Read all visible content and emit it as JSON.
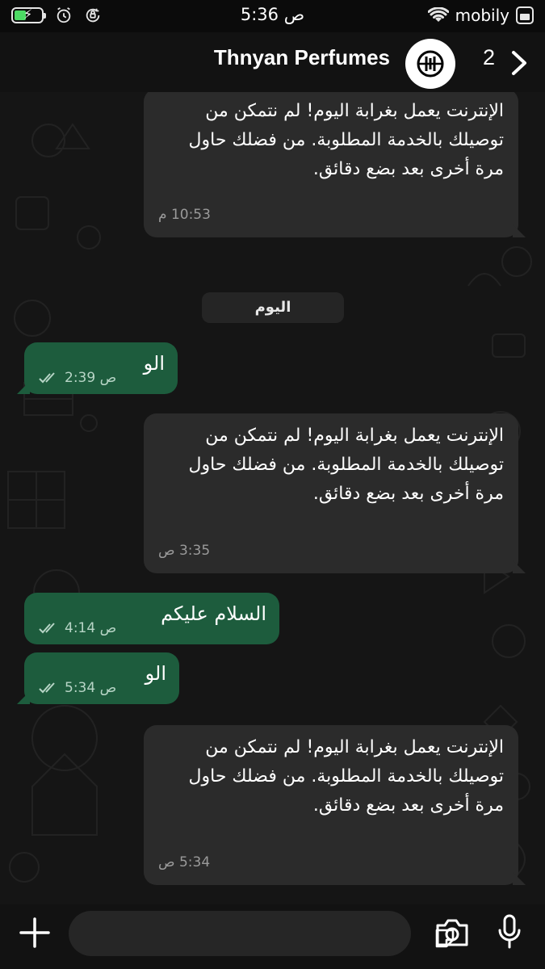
{
  "status_bar": {
    "time": "5:36 ص",
    "carrier": "mobily",
    "icons": [
      "battery-charging-icon",
      "alarm-icon",
      "orientation-lock-icon",
      "wifi-icon",
      "battery-icon"
    ]
  },
  "header": {
    "contact_name": "Thnyan Perfumes",
    "unread_count": "2",
    "avatar_icon": "business-logo-icon",
    "forward_icon": "chevron-right-icon"
  },
  "messages": [
    {
      "direction": "in",
      "text": "الإنترنت يعمل بغرابة اليوم! لم نتمكن من توصيلك بالخدمة المطلوبة. من فضلك حاول مرة أخرى بعد بضع دقائق.",
      "time": "10:53 م"
    },
    {
      "direction": "out",
      "text": "الو",
      "time": "2:39 ص",
      "status": "read"
    },
    {
      "direction": "in",
      "text": "الإنترنت يعمل بغرابة اليوم! لم نتمكن من توصيلك بالخدمة المطلوبة. من فضلك حاول مرة أخرى بعد بضع دقائق.",
      "time": "3:35 ص"
    },
    {
      "direction": "out",
      "text": "السلام عليكم",
      "time": "4:14 ص",
      "status": "read"
    },
    {
      "direction": "out",
      "text": "الو",
      "time": "5:34 ص",
      "status": "read"
    },
    {
      "direction": "in",
      "text": "الإنترنت يعمل بغرابة اليوم! لم نتمكن من توصيلك بالخدمة المطلوبة. من فضلك حاول مرة أخرى بعد بضع دقائق.",
      "time": "5:34 ص"
    }
  ],
  "date_divider": "اليوم",
  "input_bar": {
    "placeholder": "",
    "icons": [
      "plus-icon",
      "sticker-icon",
      "camera-icon",
      "microphone-icon"
    ]
  },
  "colors": {
    "incoming_bubble": "#2b2b2b",
    "outgoing_bubble": "#1d5c3d",
    "background": "#151515"
  }
}
